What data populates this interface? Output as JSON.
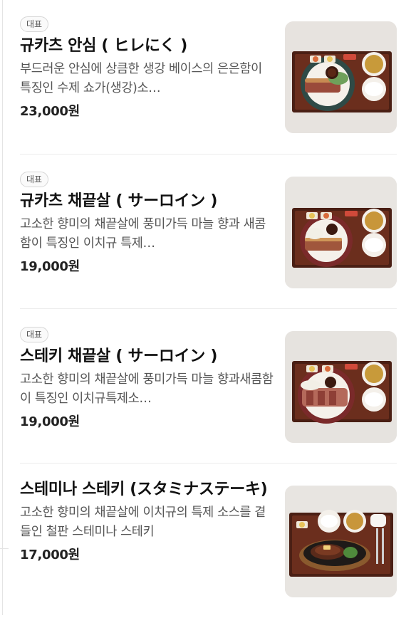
{
  "menu": {
    "items": [
      {
        "badge": "대표",
        "name": "규카츠 안심 ( ヒレにく )",
        "description": "부드러운 안심에 상큼한 생강 베이스의 은은함이 특징인 수제 쇼가(생강)소…",
        "price": "23,000원",
        "image_icon": "gyukatsu-tenderloin-set-photo"
      },
      {
        "badge": "대표",
        "name": "규카츠 채끝살 ( サーロイン )",
        "description": "고소한 향미의 채끝살에 풍미가득 마늘 향과 새콤함이 특징인 이치규 특제…",
        "price": "19,000원",
        "image_icon": "gyukatsu-sirloin-set-photo"
      },
      {
        "badge": "대표",
        "name": "스테키 채끝살 ( サーロイン )",
        "description": "고소한 향미의 채끝살에 풍미가득 마늘 향과새콤함이 특징인 이치규특제소…",
        "price": "19,000원",
        "image_icon": "sirloin-steak-set-photo"
      },
      {
        "badge": "",
        "name": "스테미나 스테키 (スタミナステーキ)",
        "description": "고소한 향미의 채끝살에 이치규의 특제 소스를 곁들인 철판 스테미나 스테키",
        "price": "17,000원",
        "image_icon": "stamina-steak-sizzling-set-photo"
      }
    ]
  }
}
